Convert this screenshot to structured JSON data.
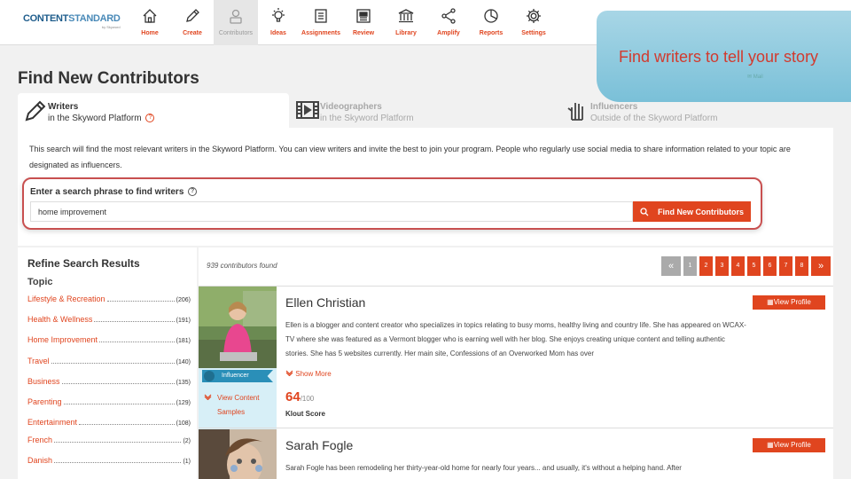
{
  "logo": {
    "line1a": "CONTENT",
    "line1b": "STANDARD",
    "line2": "by Skyword"
  },
  "nav": [
    {
      "label": "Home",
      "icon": "home-icon"
    },
    {
      "label": "Create",
      "icon": "pencil-icon"
    },
    {
      "label": "Contributors",
      "icon": "person-icon",
      "active": true
    },
    {
      "label": "Ideas",
      "icon": "lightbulb-icon"
    },
    {
      "label": "Assignments",
      "icon": "checklist-icon"
    },
    {
      "label": "Review",
      "icon": "newspaper-icon"
    },
    {
      "label": "Library",
      "icon": "library-icon"
    },
    {
      "label": "Amplify",
      "icon": "share-icon"
    },
    {
      "label": "Reports",
      "icon": "pie-chart-icon"
    },
    {
      "label": "Settings",
      "icon": "gear-icon"
    }
  ],
  "banner": {
    "text": "Find writers to tell your story",
    "mail": "✉ Mail"
  },
  "page_title": "Find New Contributors",
  "tabs": [
    {
      "title": "Writers",
      "subtitle": "in the Skyword Platform",
      "active": true
    },
    {
      "title": "Videographers",
      "subtitle": "in the Skyword Platform"
    },
    {
      "title": "Influencers",
      "subtitle": "Outside of the Skyword Platform"
    }
  ],
  "description": "This search will find the most relevant writers in the Skyword Platform. You can view writers and invite the best to join your program. People who regularly use social media to share information related to your topic are designated as influencers.",
  "search": {
    "label": "Enter a search phrase to find writers",
    "value": "home improvement",
    "button": "Find New Contributors"
  },
  "sidebar": {
    "title": "Refine Search Results",
    "section": "Topic",
    "filters": [
      {
        "name": "Lifestyle & Recreation",
        "count": "(206)"
      },
      {
        "name": "Health & Wellness",
        "count": "(191)"
      },
      {
        "name": "Home Improvement",
        "count": "(181)"
      },
      {
        "name": "Travel",
        "count": "(140)"
      },
      {
        "name": "Business",
        "count": "(135)"
      },
      {
        "name": "Parenting",
        "count": "(129)"
      },
      {
        "name": "Entertainment",
        "count": "(108)"
      },
      {
        "name": "French",
        "count": "(2)"
      },
      {
        "name": "Danish",
        "count": "(1)"
      }
    ]
  },
  "results": {
    "found": "939 contributors found",
    "pages": [
      "1",
      "2",
      "3",
      "4",
      "5",
      "6",
      "7",
      "8"
    ],
    "first_symbol": "«",
    "next_symbol": "»"
  },
  "cards": [
    {
      "name": "Ellen Christian",
      "bio": "Ellen is a blogger and content creator who specializes in topics relating to busy moms, healthy living and country life. She has appeared on WCAX-TV where she was featured as a Vermont blogger who is earning well with her blog. She enjoys creating unique content and telling authentic stories. She has 5 websites currently. Her main site, Confessions of an Overworked Mom has over",
      "view_button": "View Profile",
      "show_more": "Show More",
      "score": "64",
      "score_den": "/100",
      "score_label": "Klout Score",
      "badge": "Influencer",
      "samples": "View Content Samples"
    },
    {
      "name": "Sarah Fogle",
      "bio": "Sarah Fogle has been remodeling her thirty-year-old home for nearly four years... and usually, it's without a helping hand. After",
      "view_button": "View Profile"
    }
  ],
  "colors": {
    "accent": "#e0451f",
    "banner": "#8ccbe0",
    "badge": "#2a8fb8"
  }
}
